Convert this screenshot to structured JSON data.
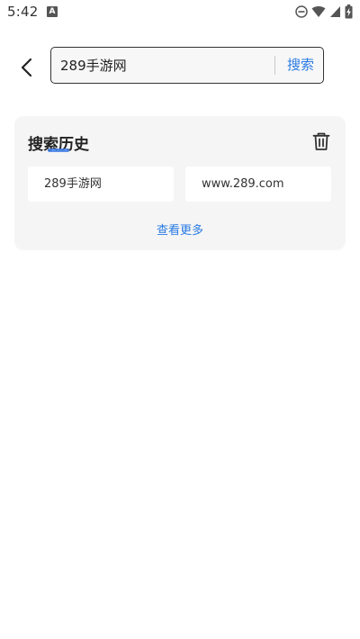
{
  "status_bar": {
    "time": "5:42",
    "notification_glyph": "A",
    "icons": [
      "dnd-icon",
      "wifi-icon",
      "signal-icon",
      "battery-charging-icon"
    ]
  },
  "search": {
    "value": "289手游网",
    "button_label": "搜索"
  },
  "history": {
    "title": "搜索历史",
    "items": [
      {
        "label": "289手游网"
      },
      {
        "label": "www.289.com"
      }
    ],
    "more_label": "查看更多"
  },
  "colors": {
    "accent": "#2a7be4",
    "card_bg": "#f5f5f5",
    "text": "#222222"
  }
}
